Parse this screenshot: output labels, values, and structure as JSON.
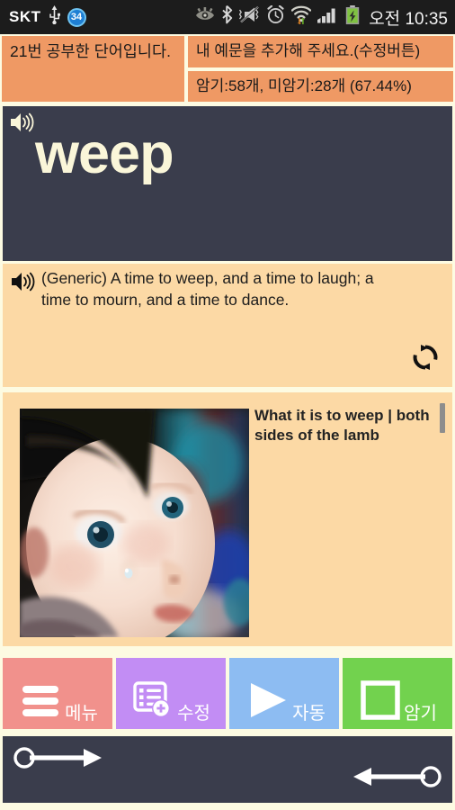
{
  "statusbar": {
    "carrier": "SKT",
    "usb_icon": "usb-icon",
    "notification_count": "34",
    "eye_icon": "eye-care-icon",
    "bluetooth_icon": "bluetooth-icon",
    "mute_icon": "vibrate-mute-icon",
    "alarm_icon": "alarm-clock-icon",
    "wifi_icon": "wifi-transfer-icon",
    "signal_icon": "cellular-signal-icon",
    "battery_icon": "battery-charging-icon",
    "clock": "오전 10:35"
  },
  "header": {
    "study_count_text": "21번 공부한 단어입니다.",
    "add_example_text": "내 예문을 추가해 주세요.(수정버튼)",
    "memorize_stats_text": "암기:58개, 미암기:28개 (67.44%)"
  },
  "word": {
    "text": "weep",
    "speaker_icon": "speaker-icon"
  },
  "sentence": {
    "text": "(Generic) A time to weep, and a time to laugh; a time to mourn, and a time to dance.",
    "speaker_icon": "speaker-icon",
    "refresh_icon": "refresh-icon"
  },
  "article": {
    "title": "What it is to weep | both sides of the lamb",
    "thumbnail_alt": "crying-baby-photo"
  },
  "buttons": [
    {
      "label": "메뉴",
      "icon": "hamburger-menu-icon",
      "color": "#f1918c",
      "name": "menu-button"
    },
    {
      "label": "수정",
      "icon": "edit-list-add-icon",
      "color": "#c28df4",
      "name": "edit-button"
    },
    {
      "label": "자동",
      "icon": "play-icon",
      "color": "#8dbcf2",
      "name": "auto-play-button"
    },
    {
      "label": "암기",
      "icon": "square-checkbox-icon",
      "color": "#72d24e",
      "name": "memorize-button"
    }
  ],
  "gestures": {
    "next_icon": "swipe-right-arrow-icon",
    "prev_icon": "swipe-left-arrow-icon"
  },
  "colors": {
    "page_background": "#fdfbe2",
    "header_orange": "#ef9964",
    "panel_dark": "#3a3d4c",
    "panel_peach": "#fcd9a5",
    "word_cream": "#faf6d9",
    "statusbar_black": "#1c1c1c"
  }
}
